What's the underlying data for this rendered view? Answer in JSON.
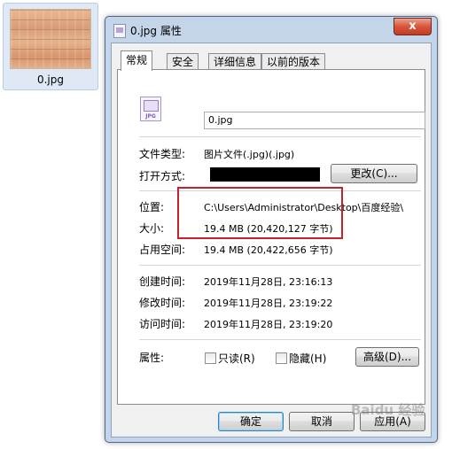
{
  "desktop": {
    "file_name": "0.jpg"
  },
  "window": {
    "title": "0.jpg 属性",
    "close_glyph": "x",
    "tabs": [
      "常规",
      "安全",
      "详细信息",
      "以前的版本"
    ],
    "active_tab": "常规",
    "icon_label": "JPG",
    "file_name_value": "0.jpg",
    "fields": {
      "type_label": "文件类型:",
      "type_value": "图片文件(.jpg)(.jpg)",
      "opener_label": "打开方式:",
      "change_button": "更改(C)...",
      "location_label": "位置:",
      "location_value": "C:\\Users\\Administrator\\Desktop\\百度经验\\",
      "size_label": "大小:",
      "size_value": "19.4 MB (20,420,127 字节)",
      "disk_size_label": "占用空间:",
      "disk_size_value": "19.4 MB (20,422,656 字节)",
      "created_label": "创建时间:",
      "created_value": "2019年11月28日, 23:16:13",
      "modified_label": "修改时间:",
      "modified_value": "2019年11月28日, 23:19:22",
      "accessed_label": "访问时间:",
      "accessed_value": "2019年11月28日, 23:19:20",
      "attributes_label": "属性:",
      "readonly_label": "只读(R)",
      "hidden_label": "隐藏(H)",
      "advanced_button": "高级(D)..."
    },
    "buttons": {
      "ok": "确定",
      "cancel": "取消",
      "apply": "应用(A)"
    }
  },
  "watermark": "Baidu 经验"
}
